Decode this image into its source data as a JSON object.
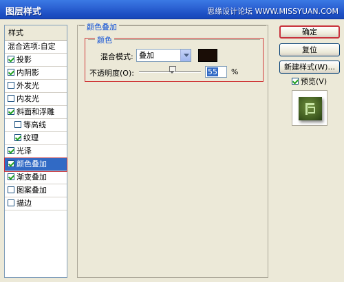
{
  "window": {
    "title": "图层样式",
    "watermark": "思缘设计论坛 WWW.MISSYUAN.COM"
  },
  "style_list": {
    "header": "样式",
    "blend_options": "混合选项:自定",
    "items": [
      {
        "label": "投影",
        "checked": true
      },
      {
        "label": "内阴影",
        "checked": true
      },
      {
        "label": "外发光",
        "checked": false
      },
      {
        "label": "内发光",
        "checked": false
      },
      {
        "label": "斜面和浮雕",
        "checked": true
      },
      {
        "label": "等高线",
        "checked": false
      },
      {
        "label": "纹理",
        "checked": true
      },
      {
        "label": "光泽",
        "checked": true
      },
      {
        "label": "颜色叠加",
        "checked": true,
        "selected": true
      },
      {
        "label": "渐变叠加",
        "checked": true
      },
      {
        "label": "图案叠加",
        "checked": false
      },
      {
        "label": "描边",
        "checked": false
      }
    ]
  },
  "color_overlay": {
    "group_title": "颜色叠加",
    "sub_title": "颜色",
    "blend_mode_label": "混合模式:",
    "blend_mode_value": "叠加",
    "color": "#1a0d06",
    "opacity_label": "不透明度(O):",
    "opacity_value": "55",
    "opacity_unit": "%"
  },
  "buttons": {
    "ok": "确定",
    "reset": "复位",
    "new_style": "新建样式(W)...",
    "preview_label": "预览(V)",
    "preview_checked": true
  }
}
